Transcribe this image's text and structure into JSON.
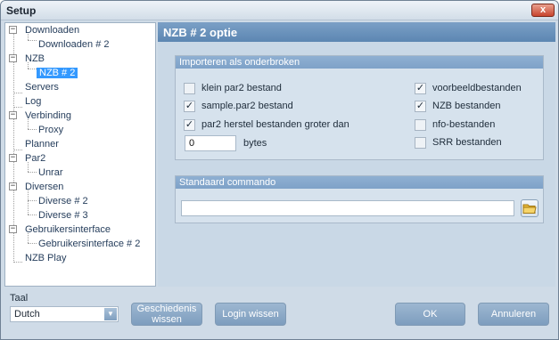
{
  "window": {
    "title": "Setup",
    "close_label": "x"
  },
  "sidebar": {
    "items": [
      {
        "label": "Downloaden"
      },
      {
        "label": "Downloaden # 2"
      },
      {
        "label": "NZB"
      },
      {
        "label": "NZB # 2"
      },
      {
        "label": "Servers"
      },
      {
        "label": "Log"
      },
      {
        "label": "Verbinding"
      },
      {
        "label": "Proxy"
      },
      {
        "label": "Planner"
      },
      {
        "label": "Par2"
      },
      {
        "label": "Unrar"
      },
      {
        "label": "Diversen"
      },
      {
        "label": "Diverse # 2"
      },
      {
        "label": "Diverse # 3"
      },
      {
        "label": "Gebruikersinterface"
      },
      {
        "label": "Gebruikersinterface # 2"
      },
      {
        "label": "NZB Play"
      }
    ]
  },
  "panel": {
    "title": "NZB # 2 optie",
    "import_group": {
      "title": "Importeren als onderbroken",
      "left": [
        {
          "label": "klein par2 bestand",
          "checked": false
        },
        {
          "label": "sample.par2 bestand",
          "checked": true
        },
        {
          "label": "par2 herstel bestanden groter dan",
          "checked": true
        }
      ],
      "right": [
        {
          "label": "voorbeeldbestanden",
          "checked": true
        },
        {
          "label": "NZB bestanden",
          "checked": true
        },
        {
          "label": "nfo-bestanden",
          "checked": false
        },
        {
          "label": "SRR bestanden",
          "checked": false
        }
      ],
      "size_value": "0",
      "size_unit": "bytes"
    },
    "command_group": {
      "title": "Standaard commando",
      "value": ""
    }
  },
  "footer": {
    "language_label": "Taal",
    "language_value": "Dutch",
    "history_button": "Geschiedenis wissen",
    "login_button": "Login wissen",
    "ok_button": "OK",
    "cancel_button": "Annuleren"
  },
  "icons": {
    "checkmark": "✓",
    "dropdown": "▼",
    "collapse": "−"
  },
  "colors": {
    "accent": "#5c86b2",
    "button": "#8aa9c8",
    "selection": "#3399ff",
    "close": "#c8442d"
  }
}
